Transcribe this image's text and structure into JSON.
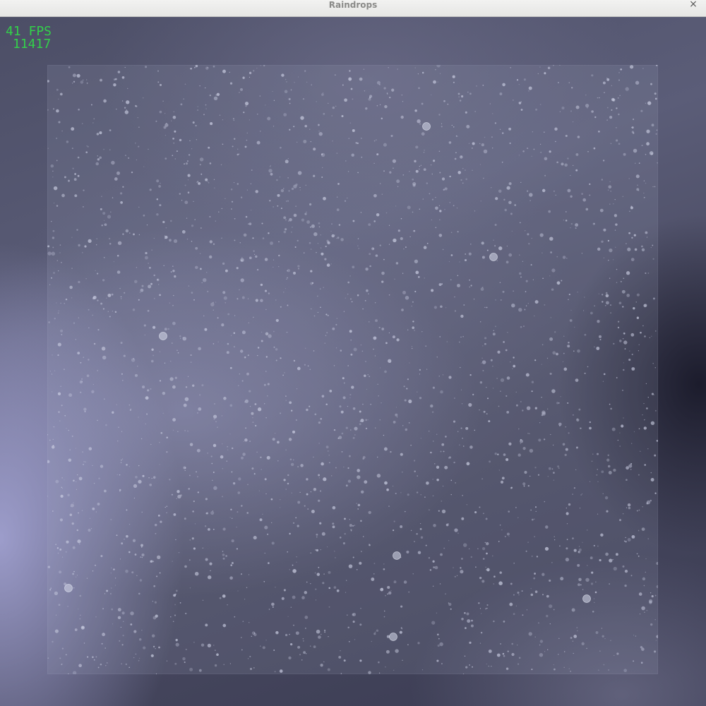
{
  "window": {
    "title": "Raindrops",
    "close_glyph": "×",
    "close_icon": "close-icon"
  },
  "hud": {
    "fps": "41 FPS",
    "count": "11417",
    "color": "#33d04a"
  },
  "scene": {
    "background_color": "#4c4e66",
    "glass_tint": "#a0a5be",
    "drop_color": "#c9cde0"
  }
}
